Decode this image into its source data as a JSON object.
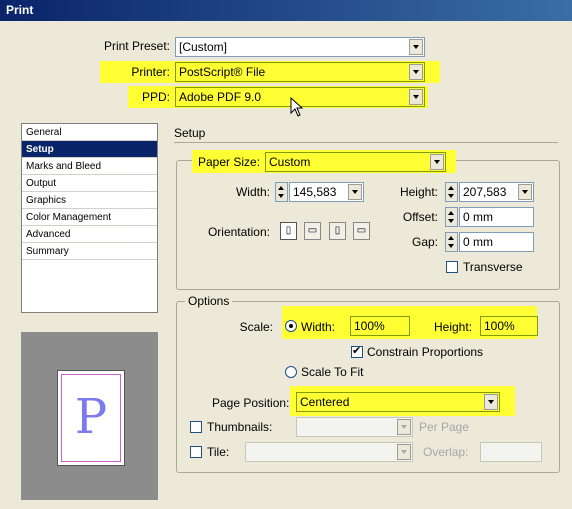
{
  "window": {
    "title": "Print"
  },
  "form": {
    "print_preset_label": "Print Preset:",
    "print_preset_value": "[Custom]",
    "printer_label": "Printer:",
    "printer_value": "PostScript® File",
    "ppd_label": "PPD:",
    "ppd_value": "Adobe PDF 9.0"
  },
  "sidebar": {
    "items": [
      {
        "label": "General"
      },
      {
        "label": "Setup"
      },
      {
        "label": "Marks and Bleed"
      },
      {
        "label": "Output"
      },
      {
        "label": "Graphics"
      },
      {
        "label": "Color Management"
      },
      {
        "label": "Advanced"
      },
      {
        "label": "Summary"
      }
    ],
    "selected": "Setup"
  },
  "preview": {
    "glyph": "P"
  },
  "setup": {
    "heading": "Setup",
    "paper_size_label": "Paper Size:",
    "paper_size_value": "Custom",
    "width_label": "Width:",
    "width_value": "145,583",
    "height_label": "Height:",
    "height_value": "207,583",
    "offset_label": "Offset:",
    "offset_value": "0 mm",
    "gap_label": "Gap:",
    "gap_value": "0 mm",
    "orientation_label": "Orientation:",
    "transverse_label": "Transverse"
  },
  "options": {
    "heading": "Options",
    "scale_label": "Scale:",
    "width_label": "Width:",
    "width_value": "100%",
    "height_label": "Height:",
    "height_value": "100%",
    "constrain_label": "Constrain Proportions",
    "scale_to_fit_label": "Scale To Fit",
    "page_position_label": "Page Position:",
    "page_position_value": "Centered",
    "thumbnails_label": "Thumbnails:",
    "per_page_label": "Per Page",
    "tile_label": "Tile:",
    "overlap_label": "Overlap:"
  },
  "colors": {
    "highlight": "#ffff33",
    "selection": "#0a246a"
  }
}
